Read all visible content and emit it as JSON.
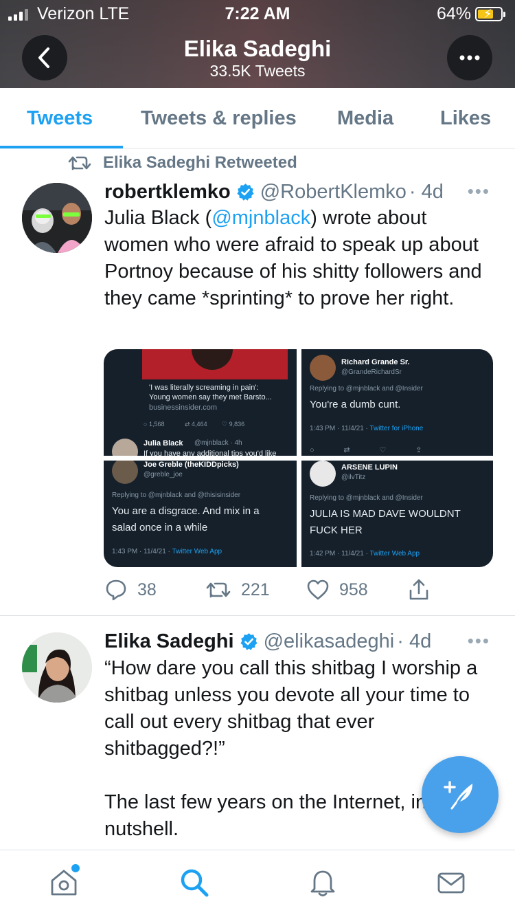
{
  "status_bar": {
    "carrier": "Verizon LTE",
    "time": "7:22 AM",
    "battery": "64%",
    "battery_level": 0.64
  },
  "header": {
    "name": "Elika Sadeghi",
    "tweet_count": "33.5K Tweets",
    "back_icon": "chevron-left-icon",
    "more_icon": "ellipsis-icon"
  },
  "tabs": [
    {
      "label": "Tweets",
      "active": true
    },
    {
      "label": "Tweets & replies",
      "active": false
    },
    {
      "label": "Media",
      "active": false
    },
    {
      "label": "Likes",
      "active": false
    }
  ],
  "tweet1": {
    "retweet_label": "Elika Sadeghi Retweeted",
    "name": "robertklemko",
    "handle": "@RobertKlemko",
    "time": "· 4d",
    "text_before": "Julia Black (",
    "mention": "@mjnblack",
    "text_after": ") wrote about women who were afraid to speak up about Portnoy because of his shitty followers and they came *sprinting* to prove her right.",
    "media": {
      "cell1": {
        "headline": "'I was literally screaming in pain':",
        "headline2": "Young women say they met Barsto...",
        "domain": "businessinsider.com",
        "replies": "1,568",
        "retweets": "4,464",
        "likes": "9,836",
        "reply_name": "Julia Black",
        "reply_handle": "@mjnblack · 4h",
        "reply_text": "If you have any additional tips you'd like"
      },
      "cell2": {
        "name": "Richard Grande Sr.",
        "handle": "@GrandeRichardSr",
        "replying": "Replying to @mjnblack and @Insider",
        "text": "You're a dumb cunt.",
        "meta": "1:43 PM · 11/4/21 · ",
        "client": "Twitter for iPhone"
      },
      "cell3": {
        "name": "Joe Greble (theKIDDpicks)",
        "handle": "@greble_joe",
        "replying": "Replying to @mjnblack and @thisisinsider",
        "text1": "You are a disgrace.  And mix in a",
        "text2": "salad once in a while",
        "meta": "1:43 PM · 11/4/21 · ",
        "client": "Twitter Web App"
      },
      "cell4": {
        "name": "ARSENE LUPIN",
        "handle": "@ilvTitz",
        "replying": "Replying to @mjnblack and @Insider",
        "text1": "JULIA IS MAD  DAVE WOULDNT",
        "text2": "FUCK HER",
        "meta": "1:42 PM · 11/4/21 · ",
        "client": "Twitter Web App"
      }
    },
    "replies": "38",
    "retweets": "221",
    "likes": "958"
  },
  "tweet2": {
    "name": "Elika Sadeghi",
    "handle": "@elikasadeghi",
    "time": "· 4d",
    "text": "“How dare you call this shitbag I worship a shitbag unless you devote all your time to call out every shitbag that ever shitbagged?!”\n\nThe last few years on the Internet, in a nutshell."
  },
  "fab": {
    "icon": "compose-tweet-icon"
  },
  "bottom_nav": [
    {
      "icon": "home-icon",
      "has_dot": true
    },
    {
      "icon": "search-icon",
      "active": true
    },
    {
      "icon": "bell-icon"
    },
    {
      "icon": "mail-icon"
    }
  ],
  "colors": {
    "accent": "#1da1f2",
    "secondary_text": "#657786",
    "fab": "#4aa1eb"
  }
}
